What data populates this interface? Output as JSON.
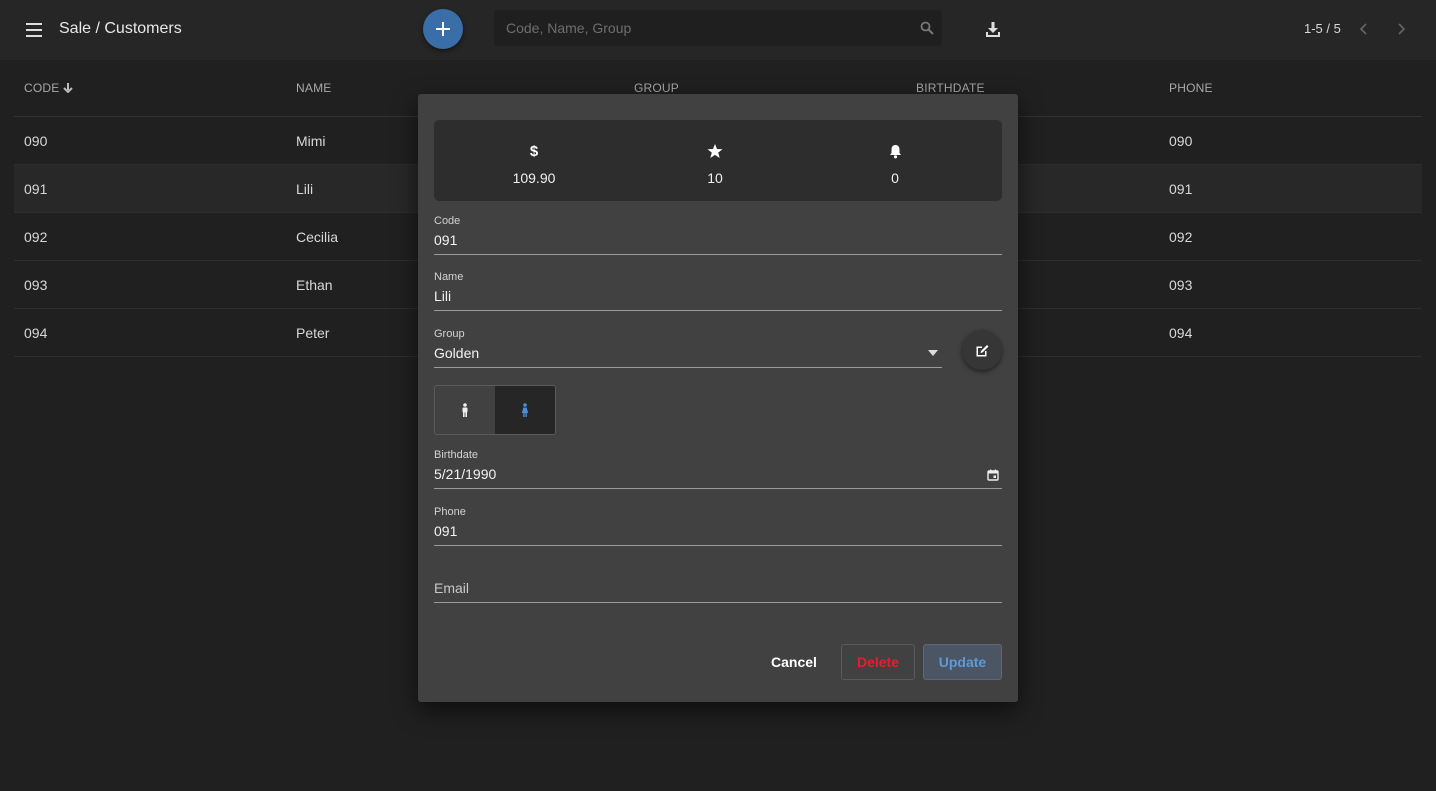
{
  "header": {
    "title": "Sale / Customers",
    "search_placeholder": "Code, Name, Group",
    "pager": "1-5 / 5"
  },
  "table": {
    "columns": [
      "CODE",
      "NAME",
      "GROUP",
      "BIRTHDATE",
      "PHONE"
    ],
    "rows": [
      {
        "code": "090",
        "name": "Mimi",
        "phone": "090"
      },
      {
        "code": "091",
        "name": "Lili",
        "phone": "091"
      },
      {
        "code": "092",
        "name": "Cecilia",
        "phone": "092"
      },
      {
        "code": "093",
        "name": "Ethan",
        "phone": "093"
      },
      {
        "code": "094",
        "name": "Peter",
        "phone": "094"
      }
    ]
  },
  "dialog": {
    "stats": {
      "amount": "109.90",
      "points": "10",
      "notifications": "0"
    },
    "code": {
      "label": "Code",
      "value": "091"
    },
    "name": {
      "label": "Name",
      "value": "Lili"
    },
    "group": {
      "label": "Group",
      "value": "Golden"
    },
    "gender": {
      "selected": "female"
    },
    "birthdate": {
      "label": "Birthdate",
      "value": "5/21/1990"
    },
    "phone": {
      "label": "Phone",
      "value": "091"
    },
    "email": {
      "placeholder": "Email",
      "value": ""
    },
    "buttons": {
      "cancel": "Cancel",
      "delete": "Delete",
      "update": "Update"
    }
  },
  "colors": {
    "accent": "#3a6ea8",
    "danger": "#e0212b",
    "selected_gender": "#4a8fd6"
  }
}
